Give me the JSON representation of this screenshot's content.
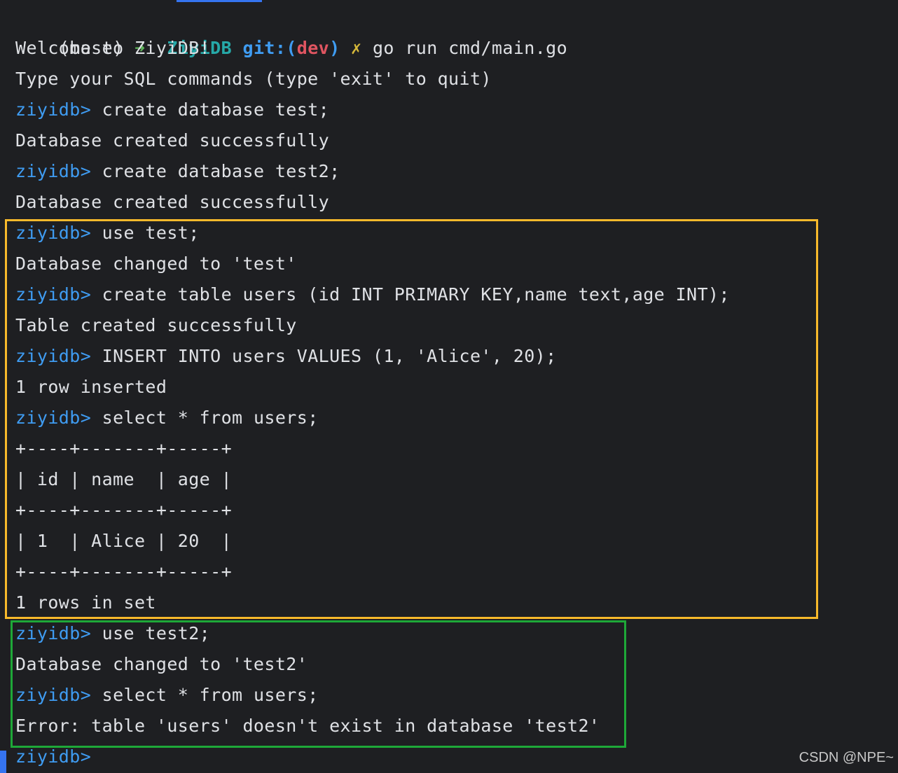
{
  "colors": {
    "background": "#1e1f22",
    "text": "#dfe1e5",
    "prompt": "#3f9cf2",
    "arrow": "#5fb35a",
    "directory": "#26a8a8",
    "branch": "#e05561",
    "dirty_marker": "#d7b93a",
    "highlight_yellow": "#f7b92b",
    "highlight_green": "#1ea838"
  },
  "shell_line": {
    "env": "(base)",
    "arrow": "➜",
    "directory": "ZiyiDB",
    "git_label": "git:(",
    "branch": "dev",
    "git_close": ")",
    "dirty": "✗",
    "command": "go run cmd/main.go"
  },
  "output": {
    "welcome": "Welcome to ZiyiDB!",
    "instructions": "Type your SQL commands (type 'exit' to quit)"
  },
  "prompt": "ziyidb> ",
  "session": [
    {
      "type": "cmd",
      "text": "create database test;"
    },
    {
      "type": "out",
      "text": "Database created successfully"
    },
    {
      "type": "cmd",
      "text": "create database test2;"
    },
    {
      "type": "out",
      "text": "Database created successfully"
    },
    {
      "type": "cmd",
      "text": "use test;"
    },
    {
      "type": "out",
      "text": "Database changed to 'test'"
    },
    {
      "type": "cmd",
      "text": "create table users (id INT PRIMARY KEY,name text,age INT);"
    },
    {
      "type": "out",
      "text": "Table created successfully"
    },
    {
      "type": "cmd",
      "text": "INSERT INTO users VALUES (1, 'Alice', 20);"
    },
    {
      "type": "out",
      "text": "1 row inserted"
    },
    {
      "type": "cmd",
      "text": "select * from users;"
    },
    {
      "type": "out",
      "text": "+----+-------+-----+"
    },
    {
      "type": "out",
      "text": "| id | name  | age |"
    },
    {
      "type": "out",
      "text": "+----+-------+-----+"
    },
    {
      "type": "out",
      "text": "| 1  | Alice | 20  |"
    },
    {
      "type": "out",
      "text": "+----+-------+-----+"
    },
    {
      "type": "out",
      "text": "1 rows in set"
    },
    {
      "type": "cmd",
      "text": "use test2;"
    },
    {
      "type": "out",
      "text": "Database changed to 'test2'"
    },
    {
      "type": "cmd",
      "text": "select * from users;"
    },
    {
      "type": "out",
      "text": "Error: table 'users' doesn't exist in database 'test2'"
    },
    {
      "type": "cmd",
      "text": ""
    }
  ],
  "watermark": "CSDN @NPE~"
}
